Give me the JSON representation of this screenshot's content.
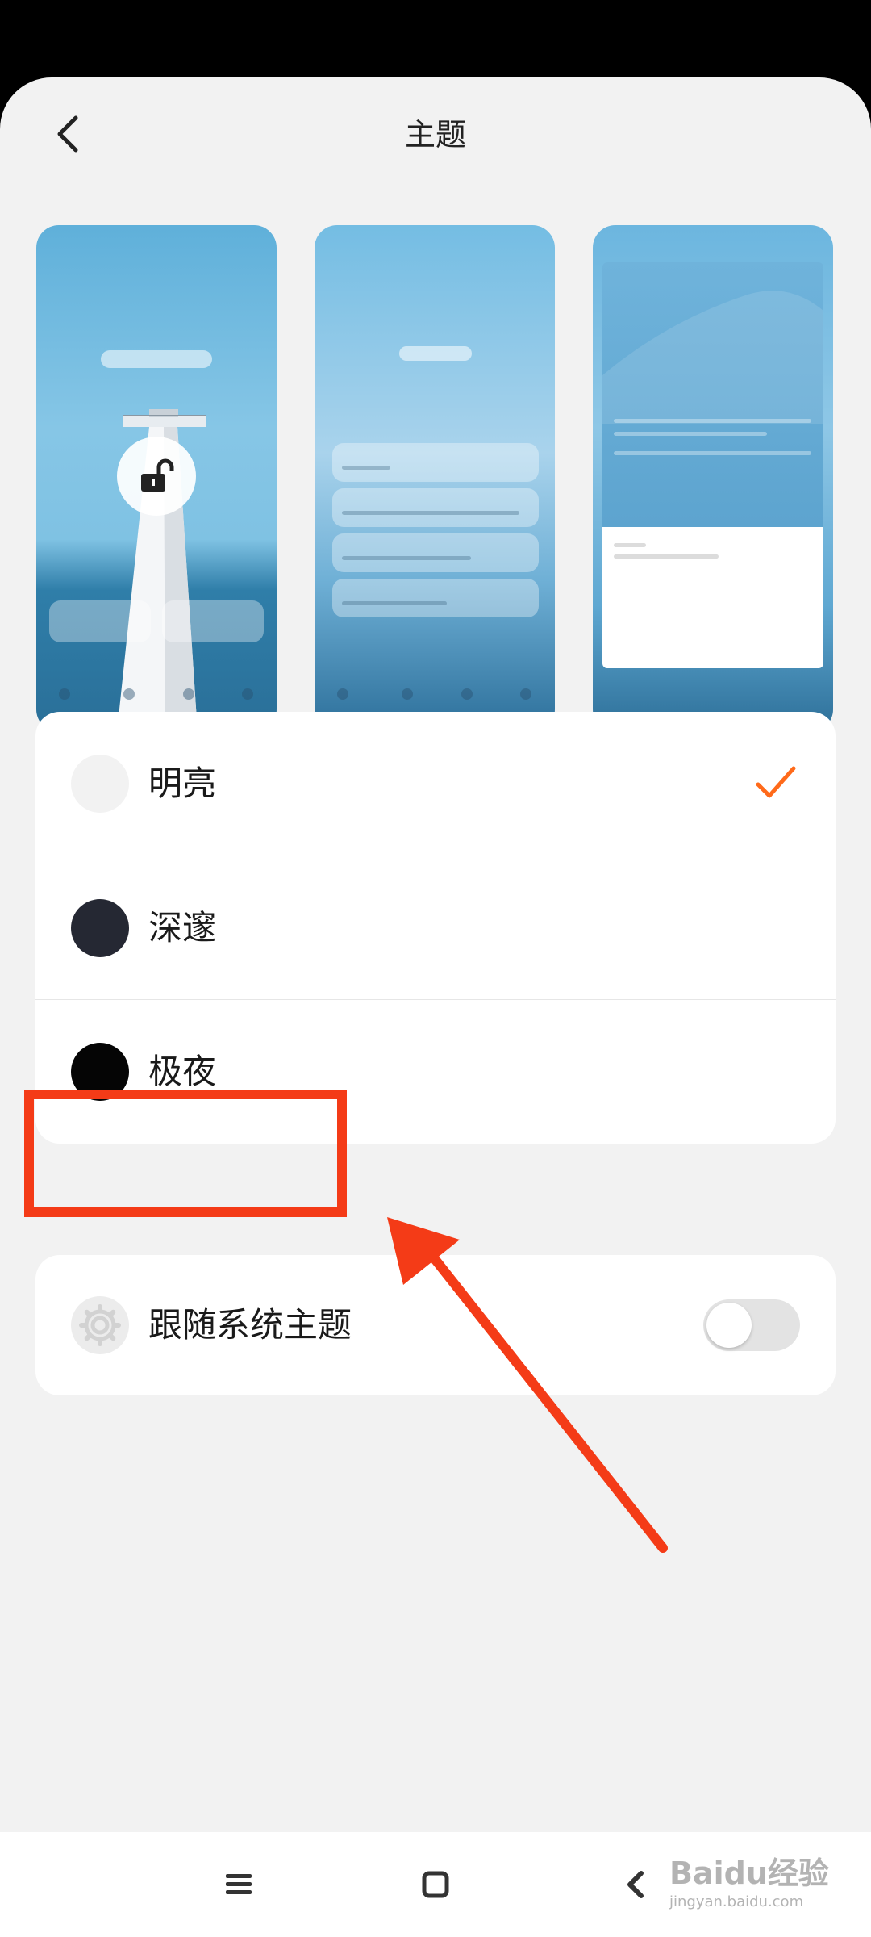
{
  "header": {
    "title": "主题"
  },
  "themes": [
    {
      "label": "明亮",
      "swatch": "#f2f2f2",
      "selected": true
    },
    {
      "label": "深邃",
      "swatch": "#252833",
      "selected": false
    },
    {
      "label": "极夜",
      "swatch": "#050505",
      "selected": false
    }
  ],
  "follow_system": {
    "label": "跟随系统主题",
    "enabled": false
  },
  "colors": {
    "accent": "#ff6a1a",
    "annotation": "#f43b17"
  },
  "watermark": {
    "main": "Baidu经验",
    "sub": "jingyan.baidu.com"
  },
  "icons": {
    "back": "chevron-left-icon",
    "check": "checkmark-icon",
    "gear": "gear-icon",
    "lock": "unlock-icon"
  }
}
